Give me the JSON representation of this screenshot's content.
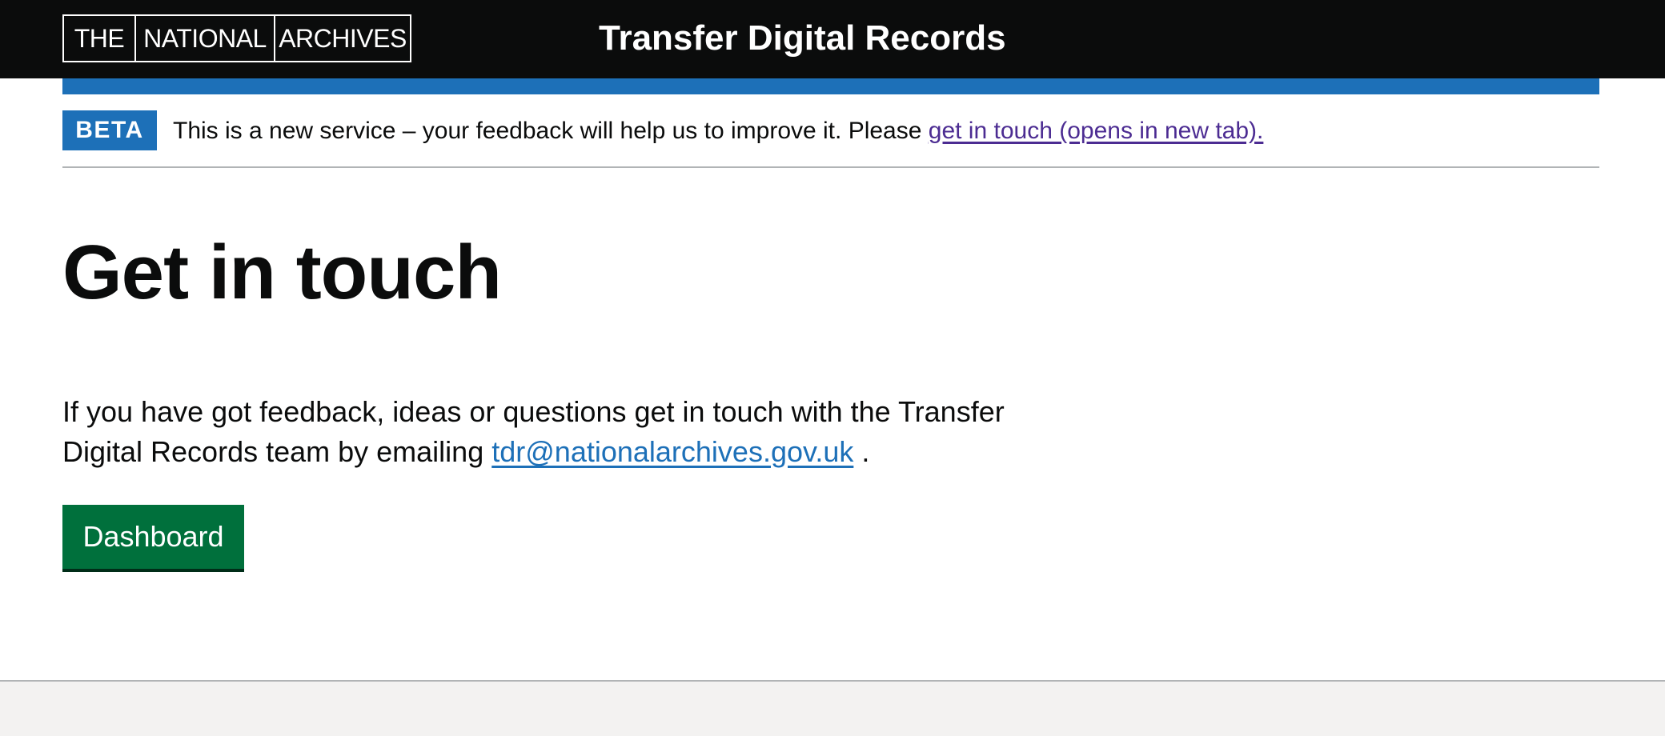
{
  "header": {
    "logo_words": [
      "THE",
      "NATIONAL",
      "ARCHIVES"
    ],
    "service_name": "Transfer Digital Records"
  },
  "phase_banner": {
    "tag": "BETA",
    "text_before": "This is a new service – your feedback will help us to improve it. Please ",
    "link_text": "get in touch (opens in new tab)."
  },
  "main": {
    "title": "Get in touch",
    "body_before": "If you have got feedback, ideas or questions get in touch with the Transfer Digital Records team by emailing ",
    "email": "tdr@nationalarchives.gov.uk",
    "body_after": " .",
    "button_label": "Dashboard"
  },
  "colors": {
    "header_bg": "#0b0c0c",
    "accent_blue": "#1d70b8",
    "visited_link": "#4c2c92",
    "button_green": "#00703c",
    "footer_bg": "#f3f2f1"
  }
}
